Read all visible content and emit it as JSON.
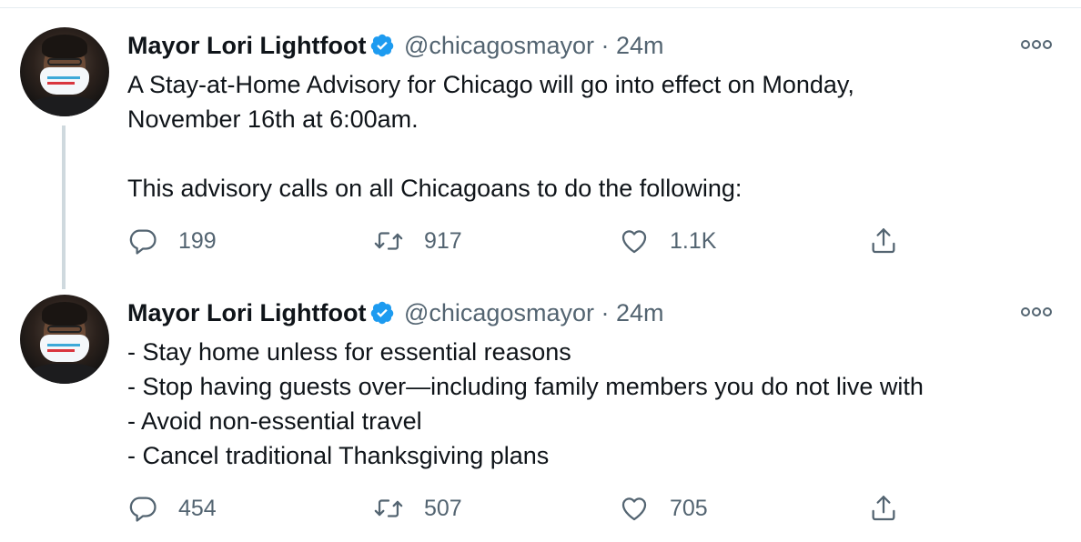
{
  "tweets": [
    {
      "author": {
        "name": "Mayor Lori Lightfoot",
        "handle": "@chicagosmayor",
        "time": "24m"
      },
      "lines": [
        "A Stay-at-Home Advisory for Chicago will go into effect on Monday,",
        "November 16th at 6:00am.",
        "",
        "This advisory calls on all Chicagoans to do the following:"
      ],
      "actions": {
        "replies": "199",
        "retweets": "917",
        "likes": "1.1K"
      }
    },
    {
      "author": {
        "name": "Mayor Lori Lightfoot",
        "handle": "@chicagosmayor",
        "time": "24m"
      },
      "lines": [
        "- Stay home unless for essential reasons",
        "- Stop having guests over—including family members you do not live with",
        "- Avoid non-essential travel",
        "- Cancel traditional Thanksgiving plans"
      ],
      "actions": {
        "replies": "454",
        "retweets": "507",
        "likes": "705"
      }
    }
  ],
  "separator": "·",
  "icons": {
    "verified": "verified-badge-icon",
    "more": "more-options-icon",
    "reply": "reply-icon",
    "retweet": "retweet-icon",
    "like": "heart-icon",
    "share": "share-icon"
  },
  "colors": {
    "verified": "#1d9bf0",
    "text": "#0f1419",
    "secondary": "#536471",
    "thread": "#cfd9de"
  }
}
